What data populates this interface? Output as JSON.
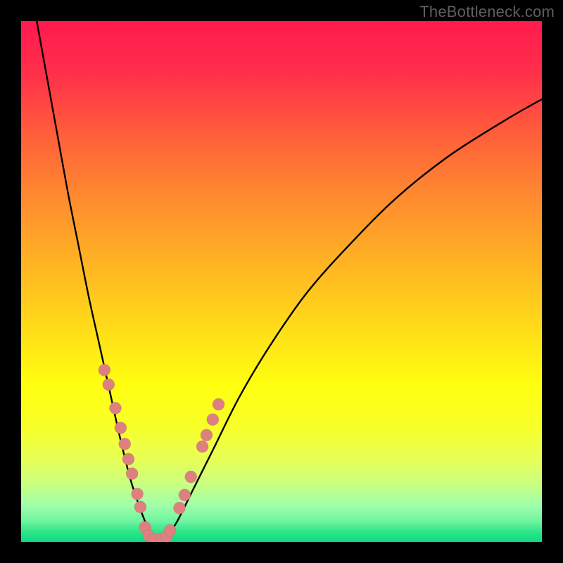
{
  "watermark": "TheBottleneck.com",
  "colors": {
    "frame_bg": "#000000",
    "marker_fill": "#df8080",
    "curve_stroke": "#000000"
  },
  "chart_data": {
    "type": "line",
    "title": "",
    "xlabel": "",
    "ylabel": "",
    "xlim": [
      0,
      100
    ],
    "ylim": [
      0,
      100
    ],
    "annotations": [],
    "series": [
      {
        "name": "left-curve",
        "x": [
          3,
          5,
          7,
          9,
          11,
          13,
          15,
          17,
          19,
          21,
          23,
          25
        ],
        "y": [
          100,
          89,
          78,
          67,
          57,
          47,
          38,
          29,
          20,
          12,
          6,
          1
        ]
      },
      {
        "name": "right-curve",
        "x": [
          28,
          30,
          33,
          37,
          42,
          48,
          55,
          63,
          72,
          82,
          93,
          100
        ],
        "y": [
          1,
          4,
          10,
          18,
          28,
          38,
          48,
          57,
          66,
          74,
          81,
          85
        ]
      }
    ],
    "markers": [
      {
        "x": 16.0,
        "y": 33.0
      },
      {
        "x": 16.8,
        "y": 30.2
      },
      {
        "x": 18.1,
        "y": 25.7
      },
      {
        "x": 19.1,
        "y": 21.9
      },
      {
        "x": 19.9,
        "y": 18.8
      },
      {
        "x": 20.6,
        "y": 15.9
      },
      {
        "x": 21.3,
        "y": 13.1
      },
      {
        "x": 22.3,
        "y": 9.2
      },
      {
        "x": 22.9,
        "y": 6.7
      },
      {
        "x": 23.8,
        "y": 2.8
      },
      {
        "x": 24.5,
        "y": 1.2
      },
      {
        "x": 25.5,
        "y": 0.5
      },
      {
        "x": 26.9,
        "y": 0.5
      },
      {
        "x": 27.9,
        "y": 1.0
      },
      {
        "x": 28.6,
        "y": 2.2
      },
      {
        "x": 30.4,
        "y": 6.5
      },
      {
        "x": 31.4,
        "y": 9.0
      },
      {
        "x": 32.6,
        "y": 12.5
      },
      {
        "x": 34.8,
        "y": 18.3
      },
      {
        "x": 35.6,
        "y": 20.5
      },
      {
        "x": 36.8,
        "y": 23.5
      },
      {
        "x": 37.9,
        "y": 26.4
      }
    ]
  }
}
